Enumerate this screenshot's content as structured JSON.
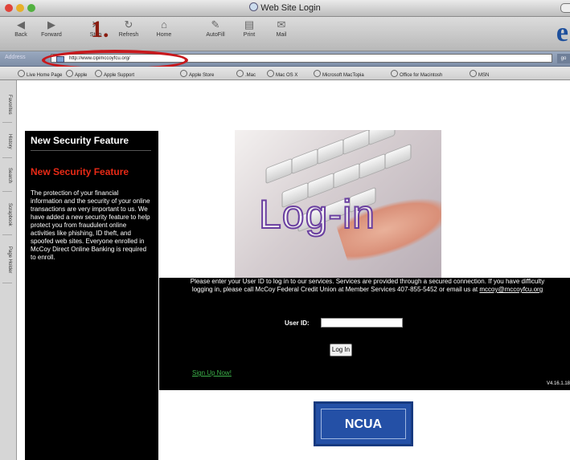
{
  "window": {
    "title": "Web Site Login",
    "traffic_lights": [
      "#e0443a",
      "#e7b02a",
      "#52b140"
    ]
  },
  "toolbar": {
    "buttons": [
      {
        "label": "Back",
        "icon": "back-arrow-icon"
      },
      {
        "label": "Forward",
        "icon": "forward-arrow-icon"
      },
      {
        "label": "Stop",
        "icon": "stop-icon"
      },
      {
        "label": "Refresh",
        "icon": "refresh-icon"
      },
      {
        "label": "Home",
        "icon": "home-icon"
      },
      {
        "label": "AutoFill",
        "icon": "autofill-icon"
      },
      {
        "label": "Print",
        "icon": "print-icon"
      },
      {
        "label": "Mail",
        "icon": "mail-icon"
      }
    ],
    "logo": "e",
    "step_annotation": "1."
  },
  "address": {
    "label": "Address",
    "url": "http://www.cipimccoyfcu.org/",
    "go": "go"
  },
  "favorites": [
    "Live Home Page",
    "Apple",
    "Apple Support",
    "Apple Store",
    ".Mac",
    "Mac OS X",
    "Microsoft MacTopia",
    "Office for Macintosh",
    "MSN"
  ],
  "side_tabs": [
    "Favorites",
    "History",
    "Search",
    "Scrapbook",
    "Page Holder"
  ],
  "security_panel": {
    "heading": "New Security Feature",
    "subheading": "New Security Feature",
    "body": "The protection of your financial information and the security of your online transactions are very important to us. We have added a new security feature to help protect you from fraudulent online activities like phishing, ID theft, and spoofed web sites. Everyone enrolled in McCoy Direct Online Banking is required to enroll."
  },
  "hero": {
    "text": "Log-in"
  },
  "login": {
    "message": "Please enter your User ID to log in to our services. Services are provided through a secured connection. If you have difficulty logging in, please call McCoy Federal Credit Union at Member Services 407-855-5452 or email us at",
    "email": "mccoy@mccoyfcu.org",
    "user_id_label": "User ID:",
    "user_id_value": "",
    "button": "Log In",
    "signup": "Sign Up Now!",
    "version": "V4.16.1.18"
  },
  "badge": {
    "text": "NCUA"
  }
}
